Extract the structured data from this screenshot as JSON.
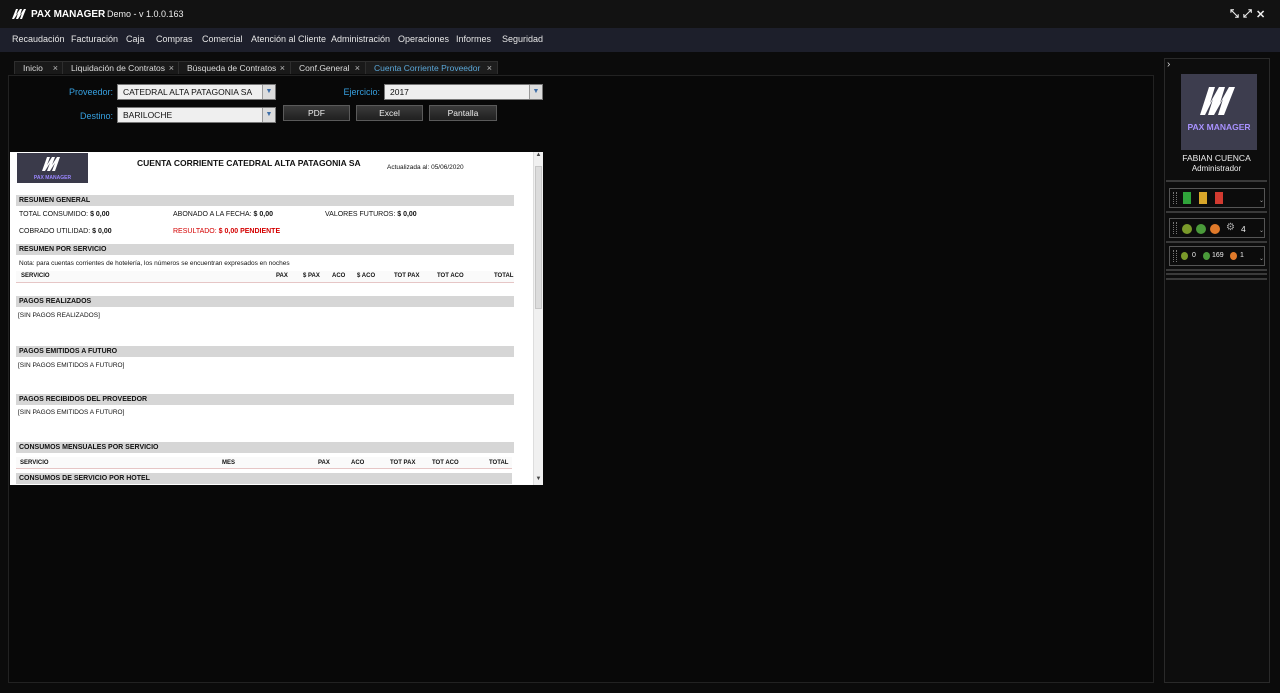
{
  "app": {
    "logo_text": "PAX MANAGER",
    "title": "Demo - v 1.0.0.163"
  },
  "menu": [
    "Recaudación",
    "Facturación",
    "Caja",
    "Compras",
    "Comercial",
    "Atención al Cliente",
    "Administración",
    "Operaciones",
    "Informes",
    "Seguridad"
  ],
  "tabs": [
    {
      "label": "Inicio",
      "active": false
    },
    {
      "label": "Liquidación de Contratos",
      "active": false
    },
    {
      "label": "Búsqueda de Contratos",
      "active": false
    },
    {
      "label": "Conf.General",
      "active": false
    },
    {
      "label": "Cuenta Corriente Proveedor",
      "active": true
    }
  ],
  "tab_close": "×",
  "form": {
    "proveedor_label": "Proveedor:",
    "proveedor_value": "CATEDRAL ALTA PATAGONIA SA",
    "destino_label": "Destino:",
    "destino_value": "BARILOCHE",
    "ejercicio_label": "Ejercicio:",
    "ejercicio_value": "2017",
    "pdf_label": "PDF",
    "excel_label": "Excel",
    "pantalla_label": "Pantalla"
  },
  "report": {
    "logo_text": "PAX MANAGER",
    "title": "CUENTA CORRIENTE CATEDRAL ALTA PATAGONIA SA",
    "updated": "Actualizada al: 05/06/2020",
    "resumen_general": "RESUMEN GENERAL",
    "total_consumido_label": "TOTAL CONSUMIDO:",
    "total_consumido_value": "$ 0,00",
    "abonado_label": "ABONADO A LA FECHA:",
    "abonado_value": "$ 0,00",
    "valores_futuros_label": "VALORES FUTUROS:",
    "valores_futuros_value": "$ 0,00",
    "cobrado_label": "COBRADO UTILIDAD:",
    "cobrado_value": "$ 0,00",
    "resultado_label": "RESULTADO:",
    "resultado_value": "$ 0,00 PENDIENTE",
    "resumen_servicio": "RESUMEN POR SERVICIO",
    "nota": "Nota: para cuentas corrientes de hotelería, los números se encuentran expresados en noches",
    "servicio_cols": [
      "SERVICIO",
      "PAX",
      "$ PAX",
      "ACO",
      "$ ACO",
      "TOT PAX",
      "TOT ACO",
      "TOTAL"
    ],
    "pagos_realizados": "PAGOS REALIZADOS",
    "sin_pagos_realizados": "[SIN PAGOS REALIZADOS]",
    "pagos_emitidos": "PAGOS EMITIDOS A FUTURO",
    "sin_pagos_emitidos": "[SIN PAGOS EMITIDOS A FUTURO]",
    "pagos_recibidos": "PAGOS RECIBIDOS DEL PROVEEDOR",
    "sin_pagos_recibidos": "[SIN PAGOS EMITIDOS A FUTURO]",
    "consumos_mensuales": "CONSUMOS MENSUALES POR SERVICIO",
    "mensual_cols": [
      "SERVICIO",
      "MES",
      "PAX",
      "ACO",
      "TOT PAX",
      "TOT ACO",
      "TOTAL"
    ],
    "consumos_hotel": "CONSUMOS DE SERVICIO POR HOTEL"
  },
  "sidebar": {
    "expand": "›",
    "logo_text": "PAX MANAGER",
    "user_name": "FABIAN CUENCA",
    "user_role": "Administrador",
    "counter_a": "4",
    "count_1": "0",
    "count_2": "169",
    "count_3": "1"
  }
}
